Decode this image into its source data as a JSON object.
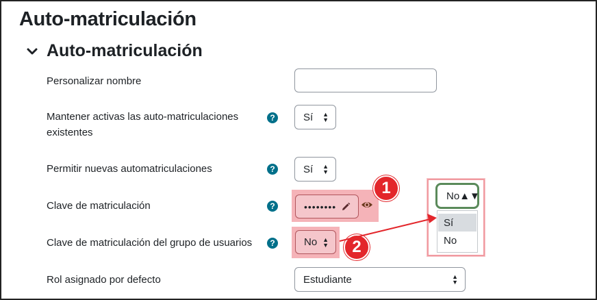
{
  "page_title": "Auto-matriculación",
  "section": {
    "title": "Auto-matriculación"
  },
  "fields": {
    "custom_name": {
      "label": "Personalizar nombre",
      "value": ""
    },
    "keep_existing": {
      "label": "Mantener activas las auto-matriculaciones existentes",
      "value": "Sí"
    },
    "allow_new": {
      "label": "Permitir nuevas automatriculaciones",
      "value": "Sí"
    },
    "enrolment_key": {
      "label": "Clave de matriculación",
      "value": "••••••••"
    },
    "group_key": {
      "label": "Clave de matriculación del grupo de usuarios",
      "value": "No"
    },
    "default_role": {
      "label": "Rol asignado por defecto",
      "value": "Estudiante"
    }
  },
  "callouts": {
    "badge1": "1",
    "badge2": "2"
  },
  "dropdown_popup": {
    "selected": "No",
    "options": [
      "Sí",
      "No"
    ],
    "highlighted": "Sí"
  },
  "help_icon_glyph": "?",
  "colors": {
    "help": "#00708a",
    "highlight": "#f5b3b8",
    "badge": "#e3262b",
    "arrow": "#e3262b"
  }
}
